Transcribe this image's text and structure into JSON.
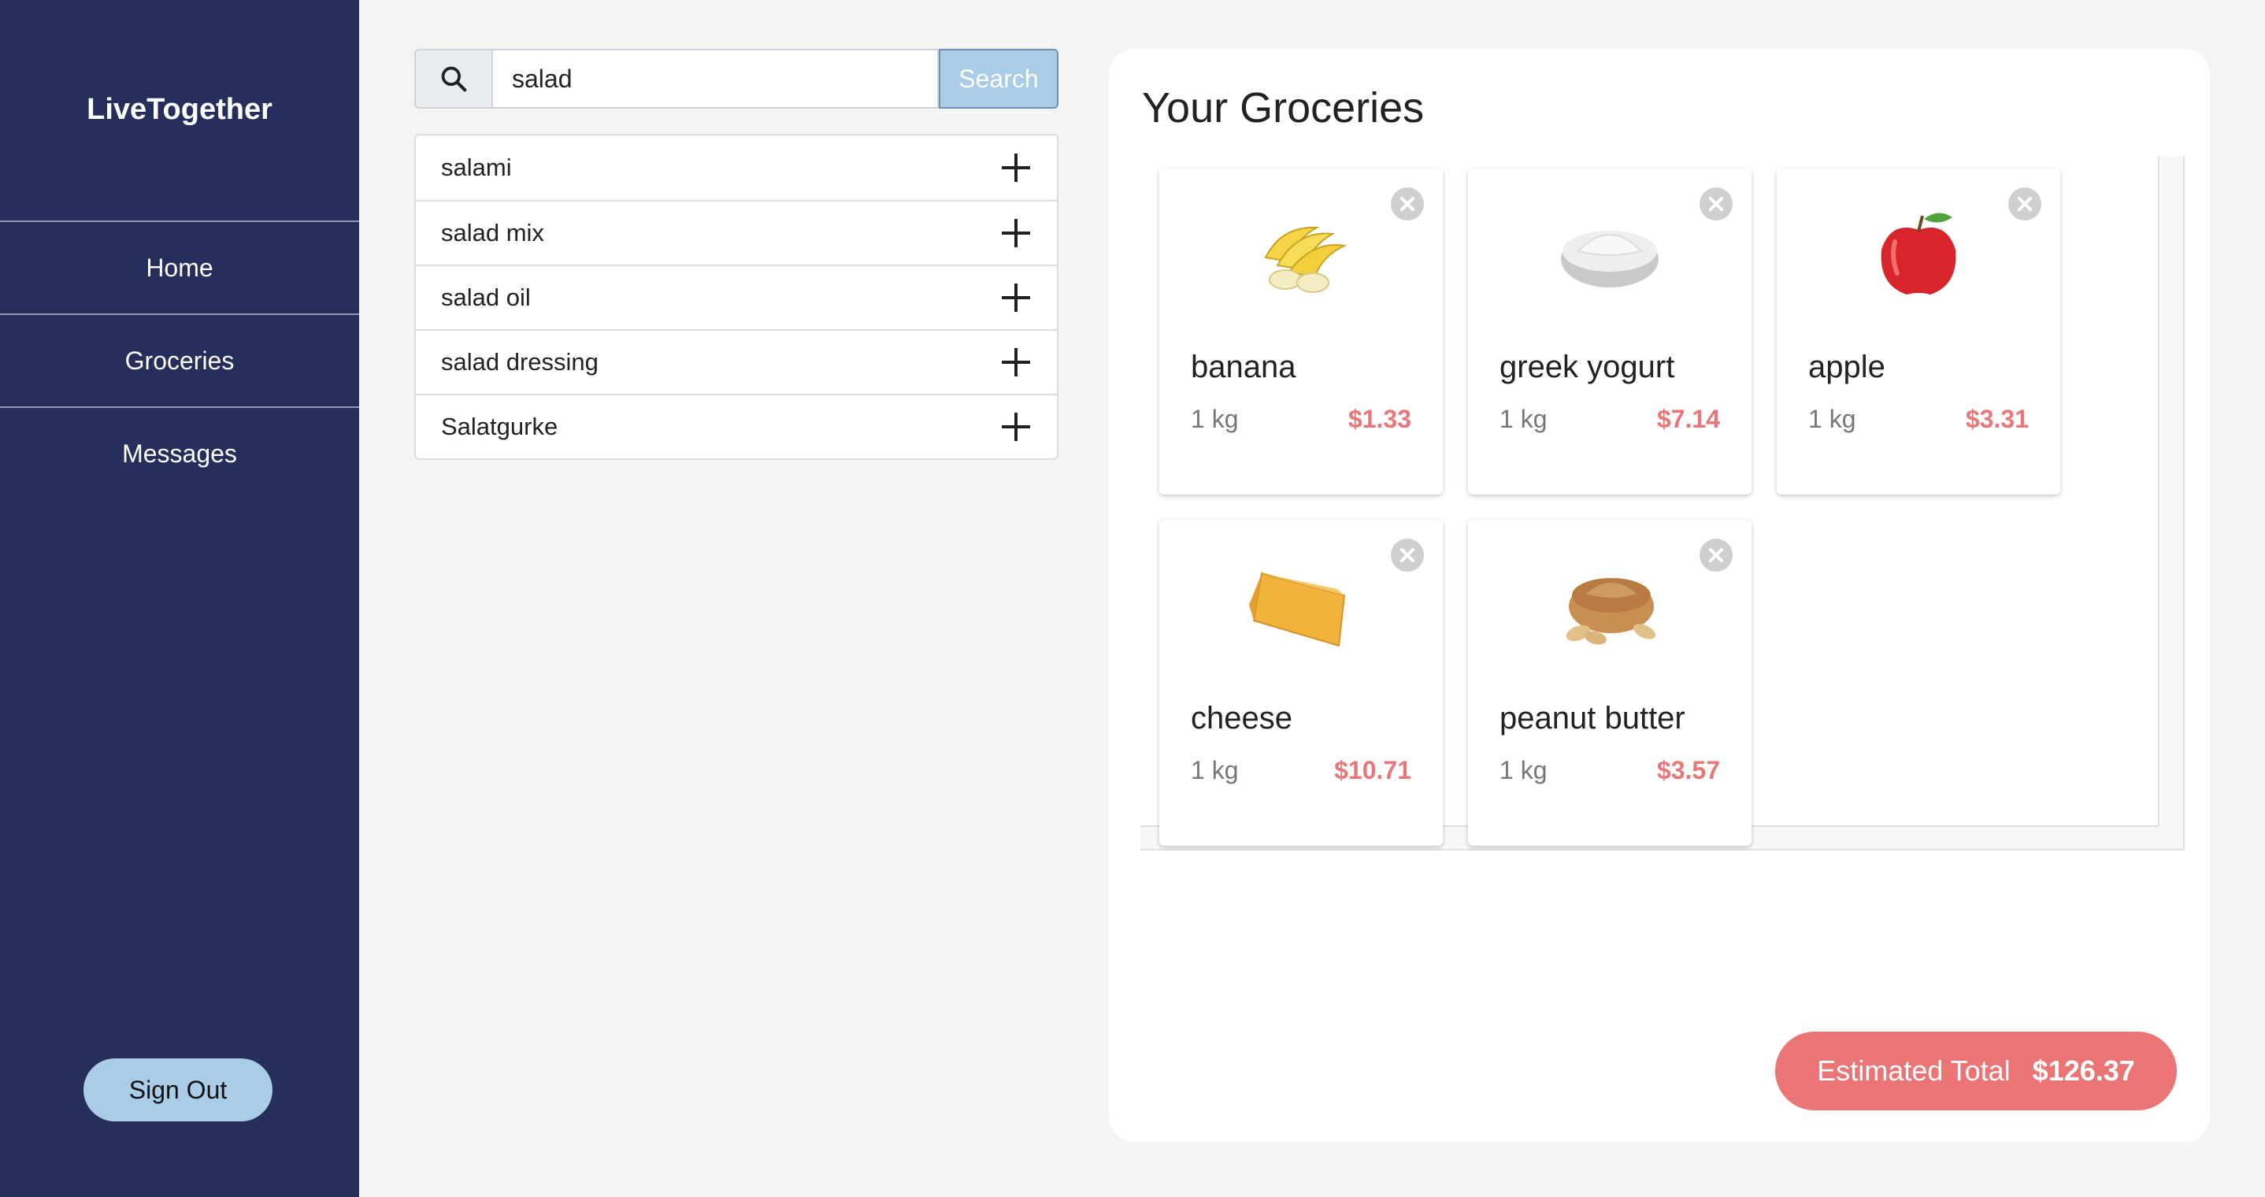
{
  "sidebar": {
    "brand": "LiveTogether",
    "nav": [
      {
        "label": "Home"
      },
      {
        "label": "Groceries"
      },
      {
        "label": "Messages"
      }
    ],
    "signout_label": "Sign Out"
  },
  "search": {
    "value": "salad",
    "button_label": "Search",
    "results": [
      {
        "label": "salami"
      },
      {
        "label": "salad mix"
      },
      {
        "label": "salad oil"
      },
      {
        "label": "salad dressing"
      },
      {
        "label": "Salatgurke"
      }
    ]
  },
  "groceries": {
    "title": "Your Groceries",
    "items": [
      {
        "name": "banana",
        "qty": "1 kg",
        "price": "$1.33",
        "icon": "banana-image"
      },
      {
        "name": "greek yogurt",
        "qty": "1 kg",
        "price": "$7.14",
        "icon": "yogurt-image"
      },
      {
        "name": "apple",
        "qty": "1 kg",
        "price": "$3.31",
        "icon": "apple-image"
      },
      {
        "name": "cheese",
        "qty": "1 kg",
        "price": "$10.71",
        "icon": "cheese-image"
      },
      {
        "name": "peanut butter",
        "qty": "1 kg",
        "price": "$3.57",
        "icon": "peanut-butter-image"
      }
    ],
    "total_label": "Estimated Total",
    "total_value": "$126.37"
  },
  "colors": {
    "sidebar": "#262e5c",
    "accent_blue": "#a9cde6",
    "price_red": "#e8777a",
    "total_bg": "#eb7475"
  }
}
